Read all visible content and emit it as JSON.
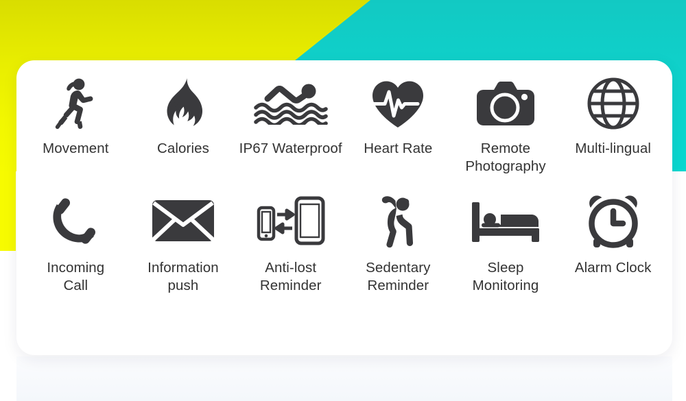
{
  "page": {
    "title": "Smart Band Feature Grid",
    "background": {
      "yellow": "#f6fb00",
      "yellow_dark": "#d9dd00",
      "teal": "#07d8d0",
      "teal_dark": "#12c9c3",
      "card": "#ffffff"
    },
    "text_color": "#333333",
    "icon_color": "#3a3a3d"
  },
  "features": [
    {
      "icon": "running-person-icon",
      "label": "Movement",
      "row": 1,
      "col": 1
    },
    {
      "icon": "flame-icon",
      "label": "Calories",
      "row": 1,
      "col": 2
    },
    {
      "icon": "swimmer-waves-icon",
      "label": "IP67 Waterproof",
      "row": 1,
      "col": 3
    },
    {
      "icon": "heart-pulse-icon",
      "label": "Heart Rate",
      "row": 1,
      "col": 4
    },
    {
      "icon": "camera-icon",
      "label": "Remote\nPhotography",
      "row": 1,
      "col": 5
    },
    {
      "icon": "globe-icon",
      "label": "Multi-lingual",
      "row": 1,
      "col": 6
    },
    {
      "icon": "phone-handset-icon",
      "label": "Incoming\nCall",
      "row": 2,
      "col": 1
    },
    {
      "icon": "envelope-icon",
      "label": "Information\npush",
      "row": 2,
      "col": 2
    },
    {
      "icon": "two-phones-sync-icon",
      "label": "Anti-lost\nReminder",
      "row": 2,
      "col": 3
    },
    {
      "icon": "stretching-person-icon",
      "label": "Sedentary\nReminder",
      "row": 2,
      "col": 4
    },
    {
      "icon": "person-in-bed-icon",
      "label": "Sleep\nMonitoring",
      "row": 2,
      "col": 5
    },
    {
      "icon": "alarm-clock-icon",
      "label": "Alarm Clock",
      "row": 2,
      "col": 6
    }
  ]
}
